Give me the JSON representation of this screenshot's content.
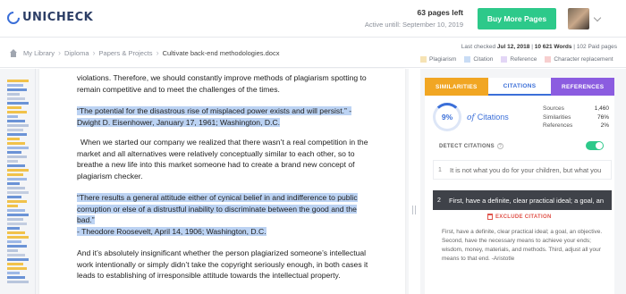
{
  "header": {
    "logo_text": "UNICHECK",
    "pages_left": "63 pages left",
    "active_until": "Active untill: September 10, 2019",
    "buy_button": "Buy More Pages"
  },
  "breadcrumb": {
    "items": [
      "My Library",
      "Diploma",
      "Papers & Projects"
    ],
    "current": "Cultivate back-end methodologies.docx",
    "separator": "›"
  },
  "doc_meta": {
    "last_checked_label": "Last checked",
    "last_checked_date": "Jul 12, 2018",
    "words": "10 621 Words",
    "paid_pages": "102 Paid pages"
  },
  "legend": [
    {
      "label": "Plagiarism",
      "color": "#f6e3b4"
    },
    {
      "label": "Citation",
      "color": "#c9dcf5"
    },
    {
      "label": "Reference",
      "color": "#e3d6f6"
    },
    {
      "label": "Character replacement",
      "color": "#f7cfcf"
    }
  ],
  "document": {
    "p1": "violations. Therefore, we should constantly improve methods of plagiarism spotting to remain competitive and to meet the challenges of the times.",
    "q1_line1": "“The potential for the disastrous rise of misplaced power exists and will persist.” -",
    "q1_line2": "Dwight D. Eisenhower, January 17, 1961; Washington, D.C.",
    "p2": "When we started our company we realized that there wasn’t a real competition in the market and all alternatives were relatively conceptually similar to each other, so to breathe a new life into this market someone had to create a brand new concept of plagiarism checker.",
    "q2_line1": "“There results a general attitude either of cynical belief in and indifference to public",
    "q2_line2": "corruption or else of a distrustful inability to discriminate between the good and the",
    "q2_line3": "bad.”",
    "q2_line4": "- Theodore Roosevelt, April 14, 1906; Washington, D.C.",
    "p3": "And it’s absolutely insignificant whether the person plagiarized someone’s intellectual work intentionally or simply didn’t take the copyright seriously enough, in both cases it leads to establishing of irresponsible attitude towards the intellectual property."
  },
  "panel": {
    "tabs": [
      "SIMILARITIES",
      "CITATIONS",
      "REFERENCES"
    ],
    "percent": "9%",
    "of_label": "of",
    "citations_label": "Citations",
    "stats": [
      {
        "label": "Sources",
        "value": "1,460"
      },
      {
        "label": "Similarities",
        "value": "76%"
      },
      {
        "label": "References",
        "value": "2%"
      }
    ],
    "detect_label": "DETECT CITATIONS",
    "detect_enabled": true,
    "items": [
      {
        "num": "1",
        "text": "It is not what you do for your children, but what you"
      },
      {
        "num": "2",
        "text": "First, have a definite, clear practical ideal; a goal, an"
      }
    ],
    "exclude_label": "EXCLUDE CITATION",
    "full_citation": "First, have a definite, clear practical ideal; a goal, an objective. Second, have the necessary means to achieve your ends; wisdom, money, materials, and methods. Third, adjust all your means to that end. -Aristotle"
  }
}
